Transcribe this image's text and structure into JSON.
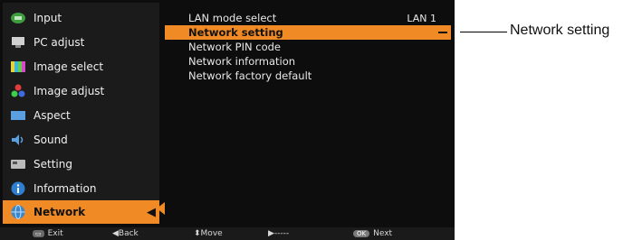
{
  "sidebar": {
    "items": [
      {
        "label": "Input",
        "icon": "input-icon"
      },
      {
        "label": "PC adjust",
        "icon": "pc-adjust-icon"
      },
      {
        "label": "Image select",
        "icon": "image-select-icon"
      },
      {
        "label": "Image adjust",
        "icon": "image-adjust-icon"
      },
      {
        "label": "Aspect",
        "icon": "aspect-icon"
      },
      {
        "label": "Sound",
        "icon": "sound-icon"
      },
      {
        "label": "Setting",
        "icon": "setting-icon"
      },
      {
        "label": "Information",
        "icon": "information-icon"
      },
      {
        "label": "Network",
        "icon": "network-icon",
        "active": true
      }
    ],
    "selected_marker": "◀"
  },
  "panel": {
    "rows": [
      {
        "label": "LAN mode select",
        "value": "LAN 1"
      },
      {
        "label": "Network setting",
        "highlighted": true
      },
      {
        "label": "Network PIN code"
      },
      {
        "label": "Network information"
      },
      {
        "label": "Network factory default"
      }
    ]
  },
  "footer": {
    "exit_key": "▭",
    "exit": "Exit",
    "back": "◀Back",
    "move": "⬍Move",
    "dashes": "▶-----",
    "ok_key": "OK",
    "next": "Next"
  },
  "callout": {
    "text": "Network setting"
  },
  "colors": {
    "accent": "#f08a24",
    "background": "#0d0d0d",
    "sidebar": "#1b1b1b"
  }
}
